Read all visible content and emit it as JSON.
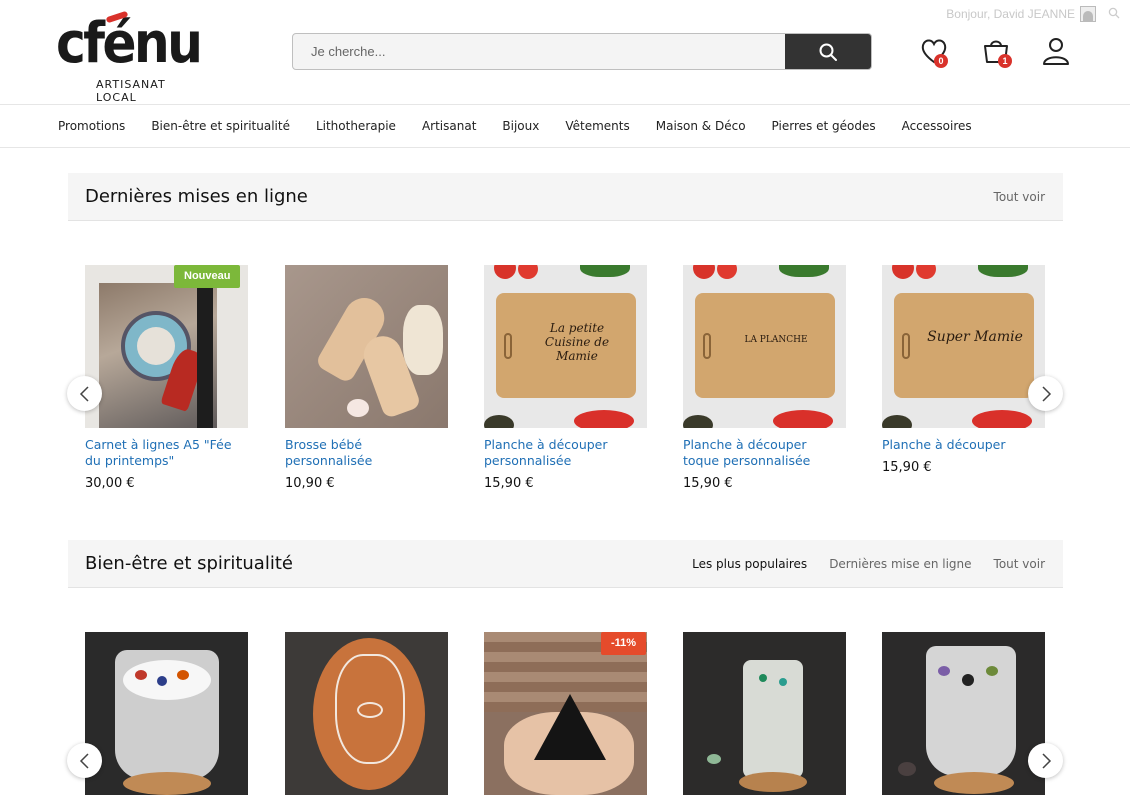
{
  "header": {
    "logo_text": "cfénu",
    "logo_subtitle": "ARTISANAT LOCAL",
    "greeting": "Bonjour, David JEANNE",
    "search_placeholder": "Je cherche...",
    "wishlist_count": "0",
    "cart_count": "1"
  },
  "nav": {
    "items": [
      "Promotions",
      "Bien-être et spiritualité",
      "Lithotherapie",
      "Artisanat",
      "Bijoux",
      "Vêtements",
      "Maison & Déco",
      "Pierres et géodes",
      "Accessoires"
    ]
  },
  "latest": {
    "title": "Dernières mises en ligne",
    "see_all": "Tout voir",
    "products": [
      {
        "title": "Carnet à lignes A5 \"Fée du printemps\"",
        "price": "30,00 €",
        "tag": "Nouveau"
      },
      {
        "title": "Brosse bébé personnalisée",
        "price": "10,90 €"
      },
      {
        "title": "Planche à découper personnalisée",
        "price": "15,90 €",
        "board_text": "La petite Cuisine de Mamie"
      },
      {
        "title": "Planche à découper toque personnalisée",
        "price": "15,90 €",
        "board_text": "LA PLANCHE"
      },
      {
        "title": "Planche à découper",
        "price": "15,90 €",
        "board_text": "Super Mamie"
      }
    ]
  },
  "wellness": {
    "title": "Bien-être et spiritualité",
    "tab_popular": "Les plus populaires",
    "tab_latest": "Dernières mise en ligne",
    "see_all": "Tout voir",
    "discount_tag": "-11%"
  },
  "colors": {
    "link_blue": "#1f6fb5",
    "new_tag_green": "#7cb83a",
    "discount_red": "#e54b2b",
    "badge_red": "#d9322b",
    "search_btn": "#333333"
  }
}
